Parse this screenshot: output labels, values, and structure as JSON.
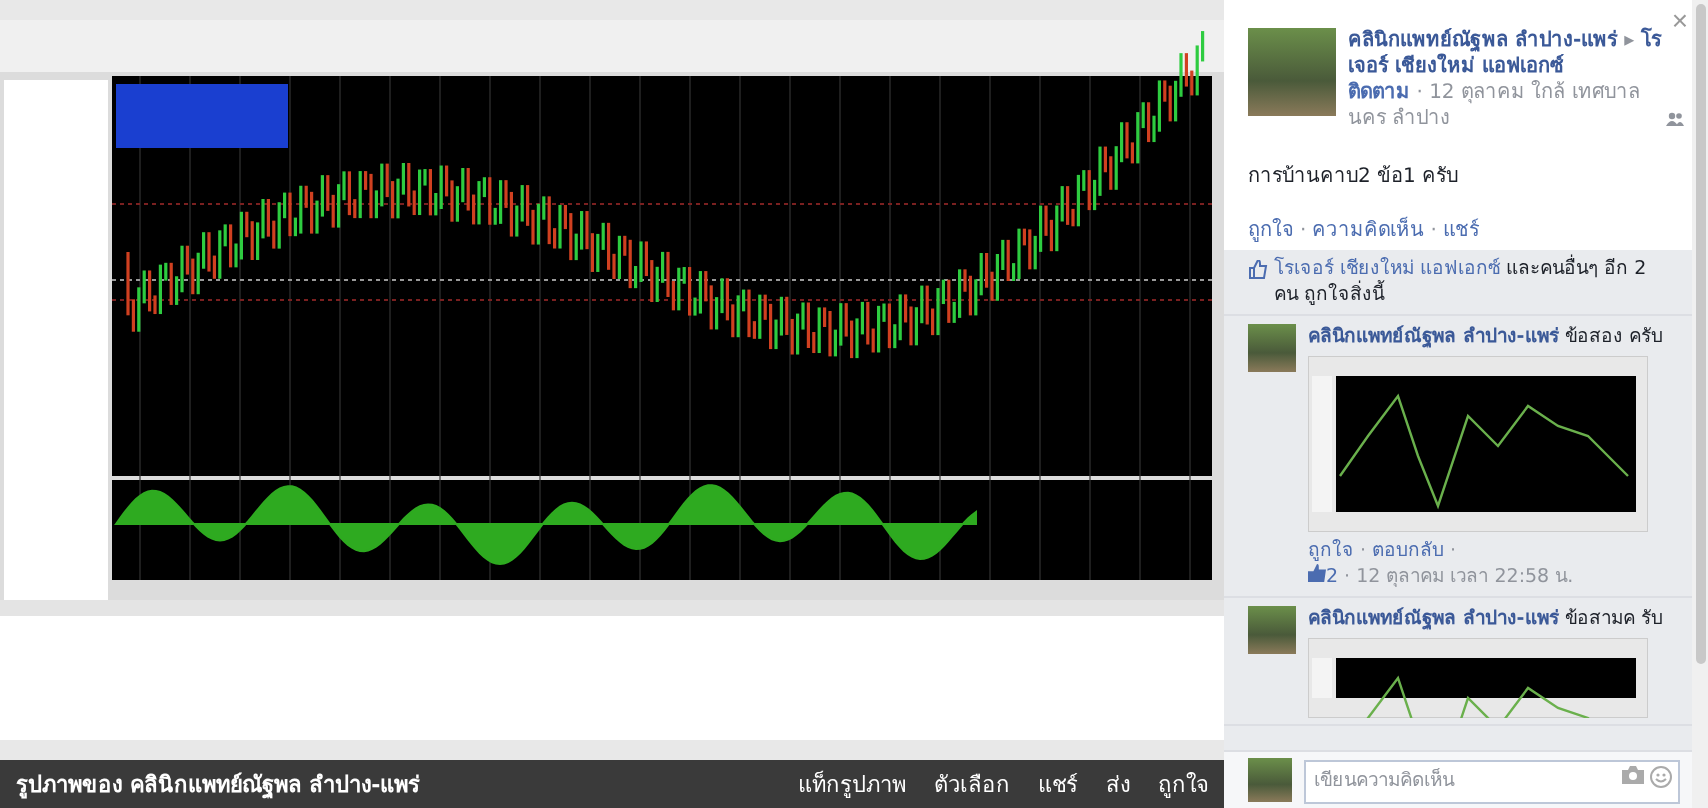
{
  "photo": {
    "caption": "รูปภาพของ คลินิกแพทย์ณัฐพล ลำปาง-แพร่",
    "actions": [
      "แท็กรูปภาพ",
      "ตัวเลือก",
      "แชร์",
      "ส่ง",
      "ถูกใจ"
    ]
  },
  "post": {
    "author": "คลินิกแพทย์ณัฐพล ลำปาง-แพร่",
    "arrow": "▸",
    "target": "โรเจอร์ เชียงใหม่ แอฟเอกซ์",
    "follow": "ติดตาม",
    "meta": "12 ตุลาคม ใกล้ เทศบาลนคร ลำปาง",
    "message": "การบ้านคาบ2 ข้อ1 ครับ",
    "actions": [
      "ถูกใจ",
      "ความคิดเห็น",
      "แชร์"
    ]
  },
  "likes": {
    "names": "โรเจอร์ เชียงใหม่ แอฟเอกซ์",
    "rest": "และคนอื่นๆ อีก 2 คน ถูกใจสิ่งนี้"
  },
  "comments": [
    {
      "author": "คลินิกแพทย์ณัฐพล ลำปาง-แพร่",
      "text": "ข้อสอง ครับ",
      "actions": [
        "ถูกใจ",
        "ตอบกลับ"
      ],
      "like_count": "2",
      "time": "12 ตุลาคม เวลา 22:58 น."
    },
    {
      "author": "คลินิกแพทย์ณัฐพล ลำปาง-แพร่",
      "text": "ข้อสามค รับ"
    }
  ],
  "comment_box": {
    "placeholder": "เขียนความคิดเห็น"
  },
  "separator": "·",
  "close": "×"
}
